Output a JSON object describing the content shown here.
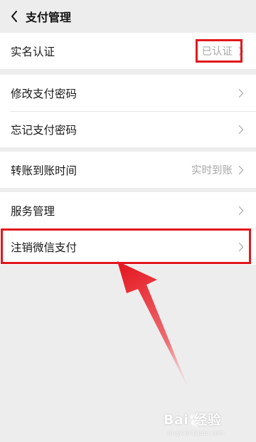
{
  "header": {
    "title": "支付管理"
  },
  "groups": [
    {
      "rows": [
        {
          "label": "实名认证",
          "value": "已认证"
        }
      ]
    },
    {
      "rows": [
        {
          "label": "修改支付密码",
          "value": ""
        },
        {
          "label": "忘记支付密码",
          "value": ""
        }
      ]
    },
    {
      "rows": [
        {
          "label": "转账到账时间",
          "value": "实时到账"
        }
      ]
    },
    {
      "rows": [
        {
          "label": "服务管理",
          "value": ""
        },
        {
          "label": "注销微信支付",
          "value": ""
        }
      ]
    }
  ],
  "colors": {
    "highlight": "#e0181d",
    "background": "#ededed"
  },
  "watermark": {
    "text": "Bai 经验",
    "sub": "jingyan.baidu.com"
  }
}
